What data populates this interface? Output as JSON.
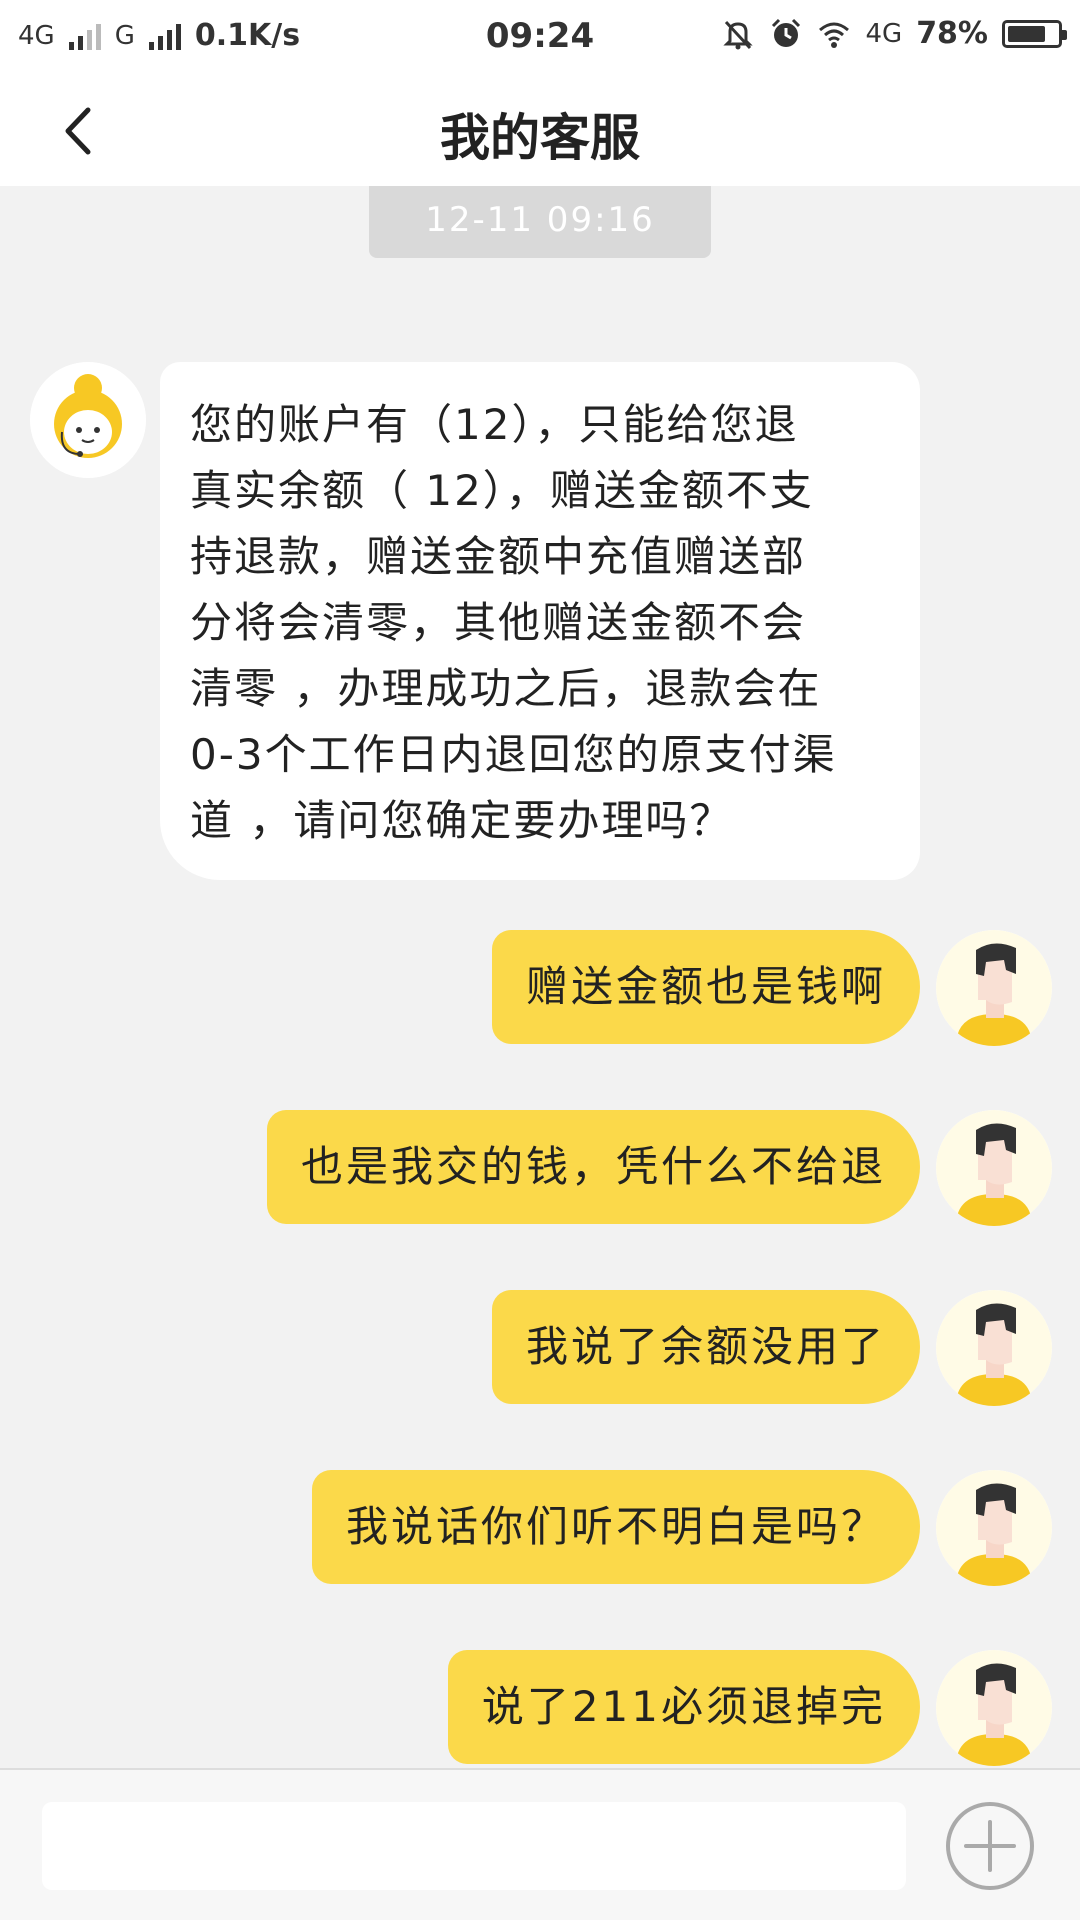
{
  "status_bar": {
    "network1": "4G",
    "network2": "G",
    "speed": "0.1K/s",
    "time": "09:24",
    "network3": "4G",
    "battery_percent": "78%",
    "battery_level": 0.78
  },
  "header": {
    "title": "我的客服",
    "back_icon": "chevron-left-icon"
  },
  "chat": {
    "timestamp": "12-11 09:16",
    "messages": [
      {
        "from": "agent",
        "lines": [
          "您的账户有（12），只能给您退",
          "真实余额（ 12），赠送金额不支",
          "持退款，赠送金额中充值赠送部",
          "分将会清零，其他赠送金额不会",
          "清零 ，办理成功之后，退款会在",
          "0-3个工作日内退回您的原支付渠",
          "道 ，请问您确定要办理吗？"
        ]
      },
      {
        "from": "user",
        "text": "赠送金额也是钱啊"
      },
      {
        "from": "user",
        "text": "也是我交的钱，凭什么不给退"
      },
      {
        "from": "user",
        "text": "我说了余额没用了"
      },
      {
        "from": "user",
        "text": "我说话你们听不明白是吗？"
      },
      {
        "from": "user",
        "text": "说了211必须退掉完"
      }
    ]
  },
  "input_bar": {
    "placeholder": "",
    "value": "",
    "add_icon": "plus-circle-icon"
  },
  "colors": {
    "user_bubble": "#fbd94a",
    "agent_bubble": "#ffffff",
    "background": "#f2f2f2",
    "timestamp_bg": "#d9d9d9"
  }
}
